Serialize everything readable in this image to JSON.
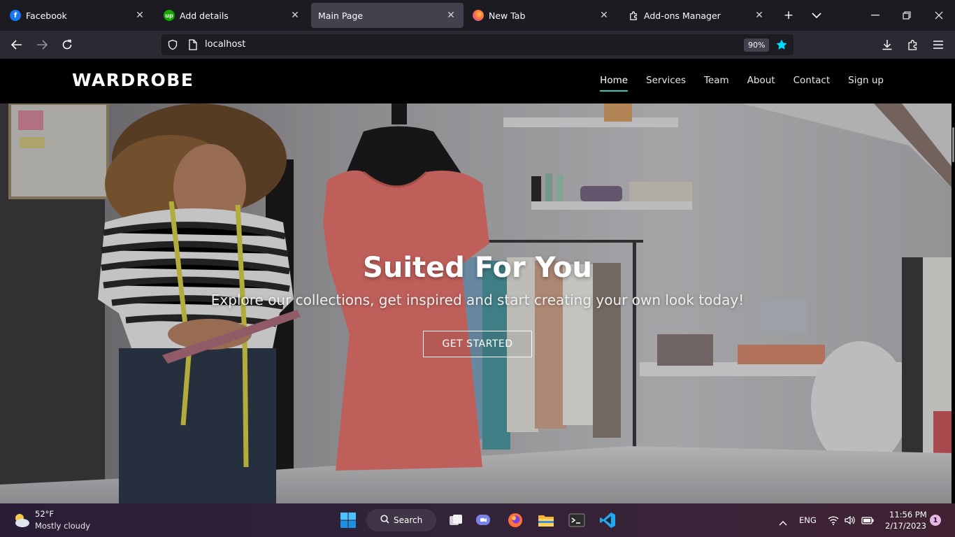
{
  "browser": {
    "tabs": [
      {
        "title": "Facebook",
        "active": false
      },
      {
        "title": "Add details",
        "active": false
      },
      {
        "title": "Main Page",
        "active": true
      },
      {
        "title": "New Tab",
        "active": false
      },
      {
        "title": "Add-ons Manager",
        "active": false
      }
    ],
    "url": "localhost",
    "zoom": "90%"
  },
  "site": {
    "logo": "WARDROBE",
    "nav": [
      {
        "label": "Home",
        "active": true
      },
      {
        "label": "Services",
        "active": false
      },
      {
        "label": "Team",
        "active": false
      },
      {
        "label": "About",
        "active": false
      },
      {
        "label": "Contact",
        "active": false
      },
      {
        "label": "Sign up",
        "active": false
      }
    ],
    "hero": {
      "title": "Suited For You",
      "subtitle": "Explore our collections, get inspired and start creating your own look today!",
      "button": "GET STARTED"
    }
  },
  "taskbar": {
    "weather_temp": "52°F",
    "weather_desc": "Mostly cloudy",
    "search_label": "Search",
    "language": "ENG",
    "time": "11:56 PM",
    "date": "2/17/2023",
    "notifications": "1"
  },
  "colors": {
    "accent": "#30c6b6",
    "header_bg": "#000000",
    "dress": "#e9756e"
  }
}
